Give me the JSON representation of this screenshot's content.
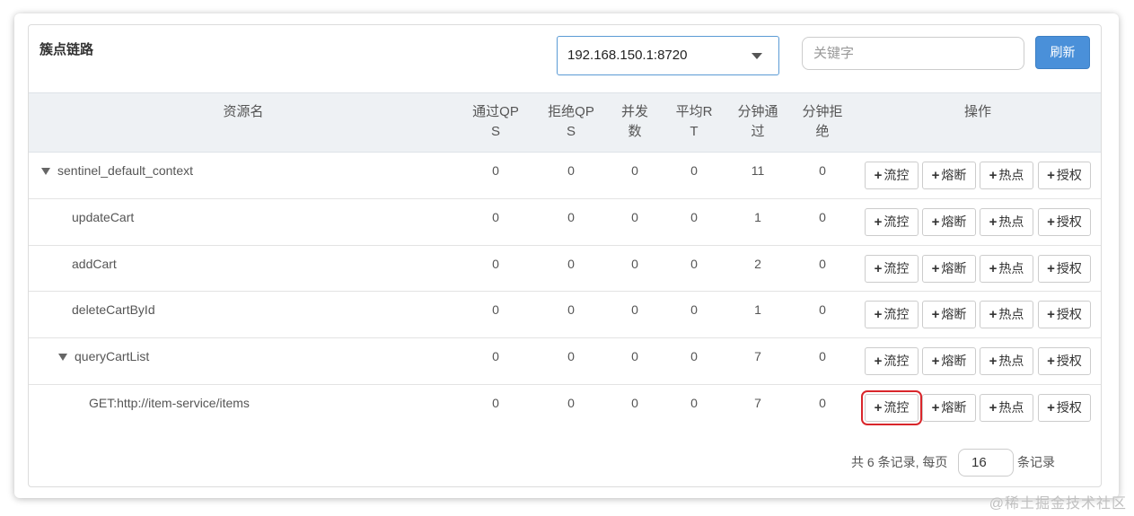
{
  "panel": {
    "title": "簇点链路"
  },
  "machine_select": {
    "value": "192.168.150.1:8720"
  },
  "search": {
    "placeholder": "关键字",
    "value": ""
  },
  "refresh_label": "刷新",
  "table": {
    "headers": [
      "资源名",
      "通过QP\nS",
      "拒绝QP\nS",
      "并发\n数",
      "平均R\nT",
      "分钟通\n过",
      "分钟拒\n绝",
      "操作"
    ],
    "op_labels": [
      "流控",
      "熔断",
      "热点",
      "授权"
    ],
    "rows": [
      {
        "name": "sentinel_default_context",
        "expanded": true,
        "pass_qps": "0",
        "block_qps": "0",
        "concurrency": "0",
        "avg_rt": "0",
        "minute_pass": "11",
        "minute_block": "0"
      },
      {
        "name": "updateCart",
        "pass_qps": "0",
        "block_qps": "0",
        "concurrency": "0",
        "avg_rt": "0",
        "minute_pass": "1",
        "minute_block": "0"
      },
      {
        "name": "addCart",
        "pass_qps": "0",
        "block_qps": "0",
        "concurrency": "0",
        "avg_rt": "0",
        "minute_pass": "2",
        "minute_block": "0"
      },
      {
        "name": "deleteCartById",
        "pass_qps": "0",
        "block_qps": "0",
        "concurrency": "0",
        "avg_rt": "0",
        "minute_pass": "1",
        "minute_block": "0"
      },
      {
        "name": "queryCartList",
        "expanded": true,
        "pass_qps": "0",
        "block_qps": "0",
        "concurrency": "0",
        "avg_rt": "0",
        "minute_pass": "7",
        "minute_block": "0"
      },
      {
        "name": "GET:http://item-service/items",
        "pass_qps": "0",
        "block_qps": "0",
        "concurrency": "0",
        "avg_rt": "0",
        "minute_pass": "7",
        "minute_block": "0"
      }
    ]
  },
  "pagination": {
    "summary": "共 6 条记录, 每页",
    "page_size": "16",
    "suffix": "条记录"
  },
  "watermark": "@稀土掘金技术社区",
  "colors": {
    "primary": "#4a90d9",
    "highlight": "#d9262b",
    "header_bg": "#eef1f4"
  }
}
